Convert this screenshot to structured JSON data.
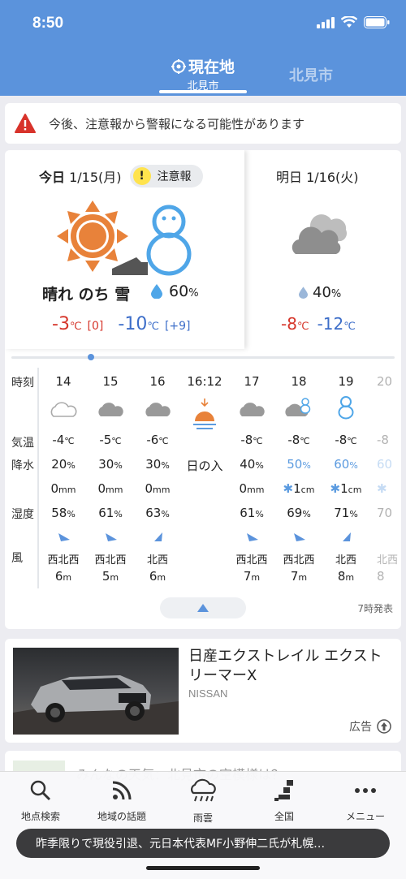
{
  "status_bar": {
    "time": "8:50"
  },
  "header": {
    "current_tab_title": "現在地",
    "current_tab_sub": "北見市",
    "other_tab": "北見市"
  },
  "alert": {
    "text": "今後、注意報から警報になる可能性があります"
  },
  "today": {
    "date_prefix": "今日",
    "date": "1/15(月)",
    "advisory": "注意報",
    "description": "晴れ のち 雪",
    "pop": "60",
    "pop_unit": "%",
    "high": "-3",
    "high_unit": "℃",
    "high_diff": "[0]",
    "low": "-10",
    "low_unit": "℃",
    "low_diff": "[+9]"
  },
  "tomorrow": {
    "date": "明日 1/16(火)",
    "pop": "40",
    "pop_unit": "%",
    "high": "-8",
    "high_unit": "℃",
    "low": "-12",
    "low_unit": "℃"
  },
  "hourly": {
    "labels": {
      "time": "時刻",
      "temp": "気温",
      "precip": "降水",
      "humidity": "湿度",
      "wind": "風"
    },
    "columns": [
      {
        "time": "14",
        "icon": "cloud-light-icon",
        "temp": "-4",
        "temp_unit": "℃",
        "pop": "20",
        "pop_unit": "%",
        "amount": "0",
        "amount_unit": "mm",
        "humidity": "58",
        "humidity_unit": "%",
        "wind_dir": "西北西",
        "wind_speed": "6",
        "wind_unit": "m"
      },
      {
        "time": "15",
        "icon": "cloud-icon",
        "temp": "-5",
        "temp_unit": "℃",
        "pop": "30",
        "pop_unit": "%",
        "amount": "0",
        "amount_unit": "mm",
        "humidity": "61",
        "humidity_unit": "%",
        "wind_dir": "西北西",
        "wind_speed": "5",
        "wind_unit": "m"
      },
      {
        "time": "16",
        "icon": "cloud-icon",
        "temp": "-6",
        "temp_unit": "℃",
        "pop": "30",
        "pop_unit": "%",
        "amount": "0",
        "amount_unit": "mm",
        "humidity": "63",
        "humidity_unit": "%",
        "wind_dir": "北西",
        "wind_speed": "6",
        "wind_unit": "m"
      },
      {
        "time": "16:12",
        "icon": "sunset-icon",
        "event": "日の入"
      },
      {
        "time": "17",
        "icon": "cloud-icon",
        "temp": "-8",
        "temp_unit": "℃",
        "pop": "40",
        "pop_unit": "%",
        "amount": "0",
        "amount_unit": "mm",
        "humidity": "61",
        "humidity_unit": "%",
        "wind_dir": "西北西",
        "wind_speed": "7",
        "wind_unit": "m"
      },
      {
        "time": "18",
        "icon": "cloud-snow-icon",
        "temp": "-8",
        "temp_unit": "℃",
        "pop": "50",
        "pop_unit": "%",
        "amount": "1",
        "amount_unit": "cm",
        "humidity": "69",
        "humidity_unit": "%",
        "wind_dir": "西北西",
        "wind_speed": "7",
        "wind_unit": "m"
      },
      {
        "time": "19",
        "icon": "snowman-icon",
        "temp": "-8",
        "temp_unit": "℃",
        "pop": "60",
        "pop_unit": "%",
        "amount": "1",
        "amount_unit": "cm",
        "humidity": "71",
        "humidity_unit": "%",
        "wind_dir": "北西",
        "wind_speed": "8",
        "wind_unit": "m"
      },
      {
        "time": "20",
        "icon": "snowman-icon",
        "temp": "-8",
        "pop": "60",
        "amount": "",
        "humidity": "70",
        "wind_dir": "北西",
        "wind_speed": "8"
      }
    ],
    "published": "7時発表"
  },
  "ad": {
    "title": "日産エクストレイル エクストリーマーX",
    "brand": "NISSAN",
    "label": "広告"
  },
  "peek": {
    "text": "みんなの天気：北見市の空模様は？"
  },
  "nav": {
    "items": [
      {
        "label": "地点検索",
        "icon": "search-icon"
      },
      {
        "label": "地域の話題",
        "icon": "rss-icon"
      },
      {
        "label": "雨雲",
        "icon": "rain-cloud-icon"
      },
      {
        "label": "全国",
        "icon": "japan-map-icon"
      },
      {
        "label": "メニュー",
        "icon": "menu-dots-icon"
      }
    ]
  },
  "news_ticker": {
    "text": "昨季限りで現役引退、元日本代表MF小野伸二氏が札幌…"
  },
  "colors": {
    "brand_blue": "#5b93dc",
    "temp_high": "#d6362b",
    "temp_low": "#3d6ec9",
    "advisory_yellow": "#ffe34d"
  }
}
